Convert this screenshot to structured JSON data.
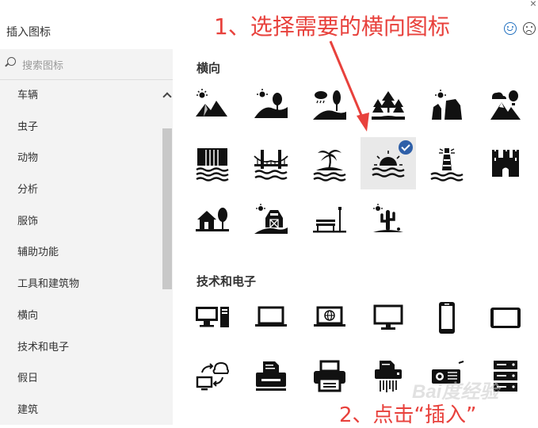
{
  "dialog": {
    "title": "插入图标",
    "close": "×",
    "feedback_happy_icon": "smile-icon",
    "feedback_sad_icon": "frown-icon"
  },
  "sidebar": {
    "search_placeholder": "搜索图标",
    "categories": [
      "车辆",
      "虫子",
      "动物",
      "分析",
      "服饰",
      "辅助功能",
      "工具和建筑物",
      "横向",
      "技术和电子",
      "假日",
      "建筑"
    ]
  },
  "sections": [
    {
      "title": "横向",
      "icons": [
        "mountain-sun-icon",
        "hill-tree-icon",
        "rain-forest-icon",
        "pine-forest-icon",
        "canyon-icon",
        "mountain-balloon-icon",
        "waterfall-icon",
        "bridge-icon",
        "island-palm-icon",
        "sunset-water-icon",
        "lighthouse-icon",
        "castle-icon",
        "house-tree-icon",
        "barn-icon",
        "park-bench-icon",
        "desert-cactus-icon"
      ],
      "selected_index": 9
    },
    {
      "title": "技术和电子",
      "icons": [
        "desktop-tower-icon",
        "laptop-icon",
        "laptop-globe-icon",
        "monitor-icon",
        "phone-icon",
        "tablet-icon",
        "network-sync-icon",
        "printer-icon",
        "printer-alt-icon",
        "shredder-icon",
        "projector-icon",
        "server-icon"
      ]
    }
  ],
  "annotations": {
    "step1": "1、选择需要的横向图标",
    "step2": "2、点击“插入”",
    "watermark": "Bai度经验",
    "accent_color": "#e8413c"
  },
  "colors": {
    "sidebar_bg": "#f3f3f3",
    "selected_bg": "#e9e9e9",
    "check": "#2e5fa8"
  }
}
